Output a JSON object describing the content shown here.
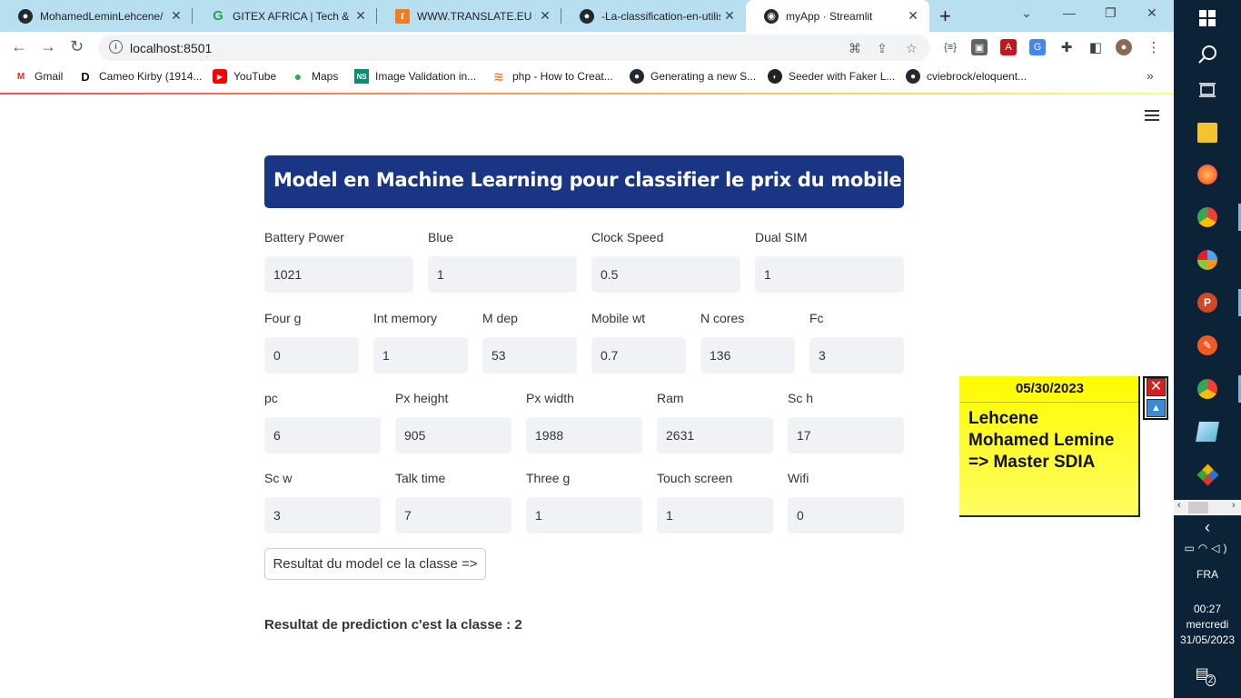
{
  "browser": {
    "tabs": [
      {
        "title": "MohamedLeminLehcene/"
      },
      {
        "title": "GITEX AFRICA | Tech & Sta"
      },
      {
        "title": "WWW.TRANSLATE.EU : On"
      },
      {
        "title": "-La-classification-en-utilis"
      },
      {
        "title": "myApp · Streamlit"
      }
    ],
    "url": "localhost:8501",
    "bookmarks": [
      {
        "label": "Gmail"
      },
      {
        "label": "Cameo Kirby (1914..."
      },
      {
        "label": "YouTube"
      },
      {
        "label": "Maps"
      },
      {
        "label": "Image Validation in..."
      },
      {
        "label": "php - How to Creat..."
      },
      {
        "label": "Generating a new S..."
      },
      {
        "label": "Seeder with Faker L..."
      },
      {
        "label": "cviebrock/eloquent..."
      }
    ]
  },
  "app": {
    "title": "Model en Machine Learning pour classifier le prix du mobile",
    "fields": [
      {
        "label": "Battery Power",
        "value": "1021"
      },
      {
        "label": "Blue",
        "value": "1"
      },
      {
        "label": "Clock Speed",
        "value": "0.5"
      },
      {
        "label": "Dual SIM",
        "value": "1"
      },
      {
        "label": "Four g",
        "value": "0"
      },
      {
        "label": "Int memory",
        "value": "1"
      },
      {
        "label": "M dep",
        "value": "53"
      },
      {
        "label": "Mobile wt",
        "value": "0.7"
      },
      {
        "label": "N cores",
        "value": "136"
      },
      {
        "label": "Fc",
        "value": "3"
      },
      {
        "label": "pc",
        "value": "6"
      },
      {
        "label": "Px height",
        "value": "905"
      },
      {
        "label": "Px width",
        "value": "1988"
      },
      {
        "label": "Ram",
        "value": "2631"
      },
      {
        "label": "Sc h",
        "value": "17"
      },
      {
        "label": "Sc w",
        "value": "3"
      },
      {
        "label": "Talk time",
        "value": "7"
      },
      {
        "label": "Three g",
        "value": "1"
      },
      {
        "label": "Touch screen",
        "value": "1"
      },
      {
        "label": "Wifi",
        "value": "0"
      }
    ],
    "button_label": "Resultat du model ce la classe =>",
    "result_text": "Resultat de prediction c'est la classe : 2"
  },
  "sticky_note": {
    "date": "05/30/2023",
    "lines": [
      "Lehcene",
      "Mohamed Lemine",
      "=> Master SDIA"
    ]
  },
  "taskbar": {
    "language": "FRA",
    "time": "00:27",
    "day": "mercredi",
    "date": "31/05/2023",
    "notifications": "2"
  }
}
